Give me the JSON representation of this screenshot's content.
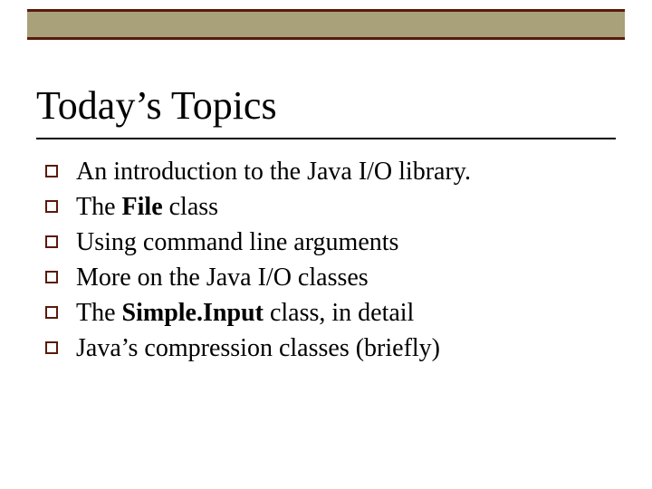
{
  "slide": {
    "title": "Today’s Topics",
    "bullets": [
      {
        "pre": "An introduction to the Java I/O library.",
        "bold": "",
        "post": ""
      },
      {
        "pre": "The ",
        "bold": "File",
        "post": " class"
      },
      {
        "pre": "Using command line arguments",
        "bold": "",
        "post": ""
      },
      {
        "pre": "More on the Java I/O classes",
        "bold": "",
        "post": ""
      },
      {
        "pre": "The ",
        "bold": "Simple.Input",
        "post": " class, in detail"
      },
      {
        "pre": "Java’s compression classes (briefly)",
        "bold": "",
        "post": ""
      }
    ]
  }
}
